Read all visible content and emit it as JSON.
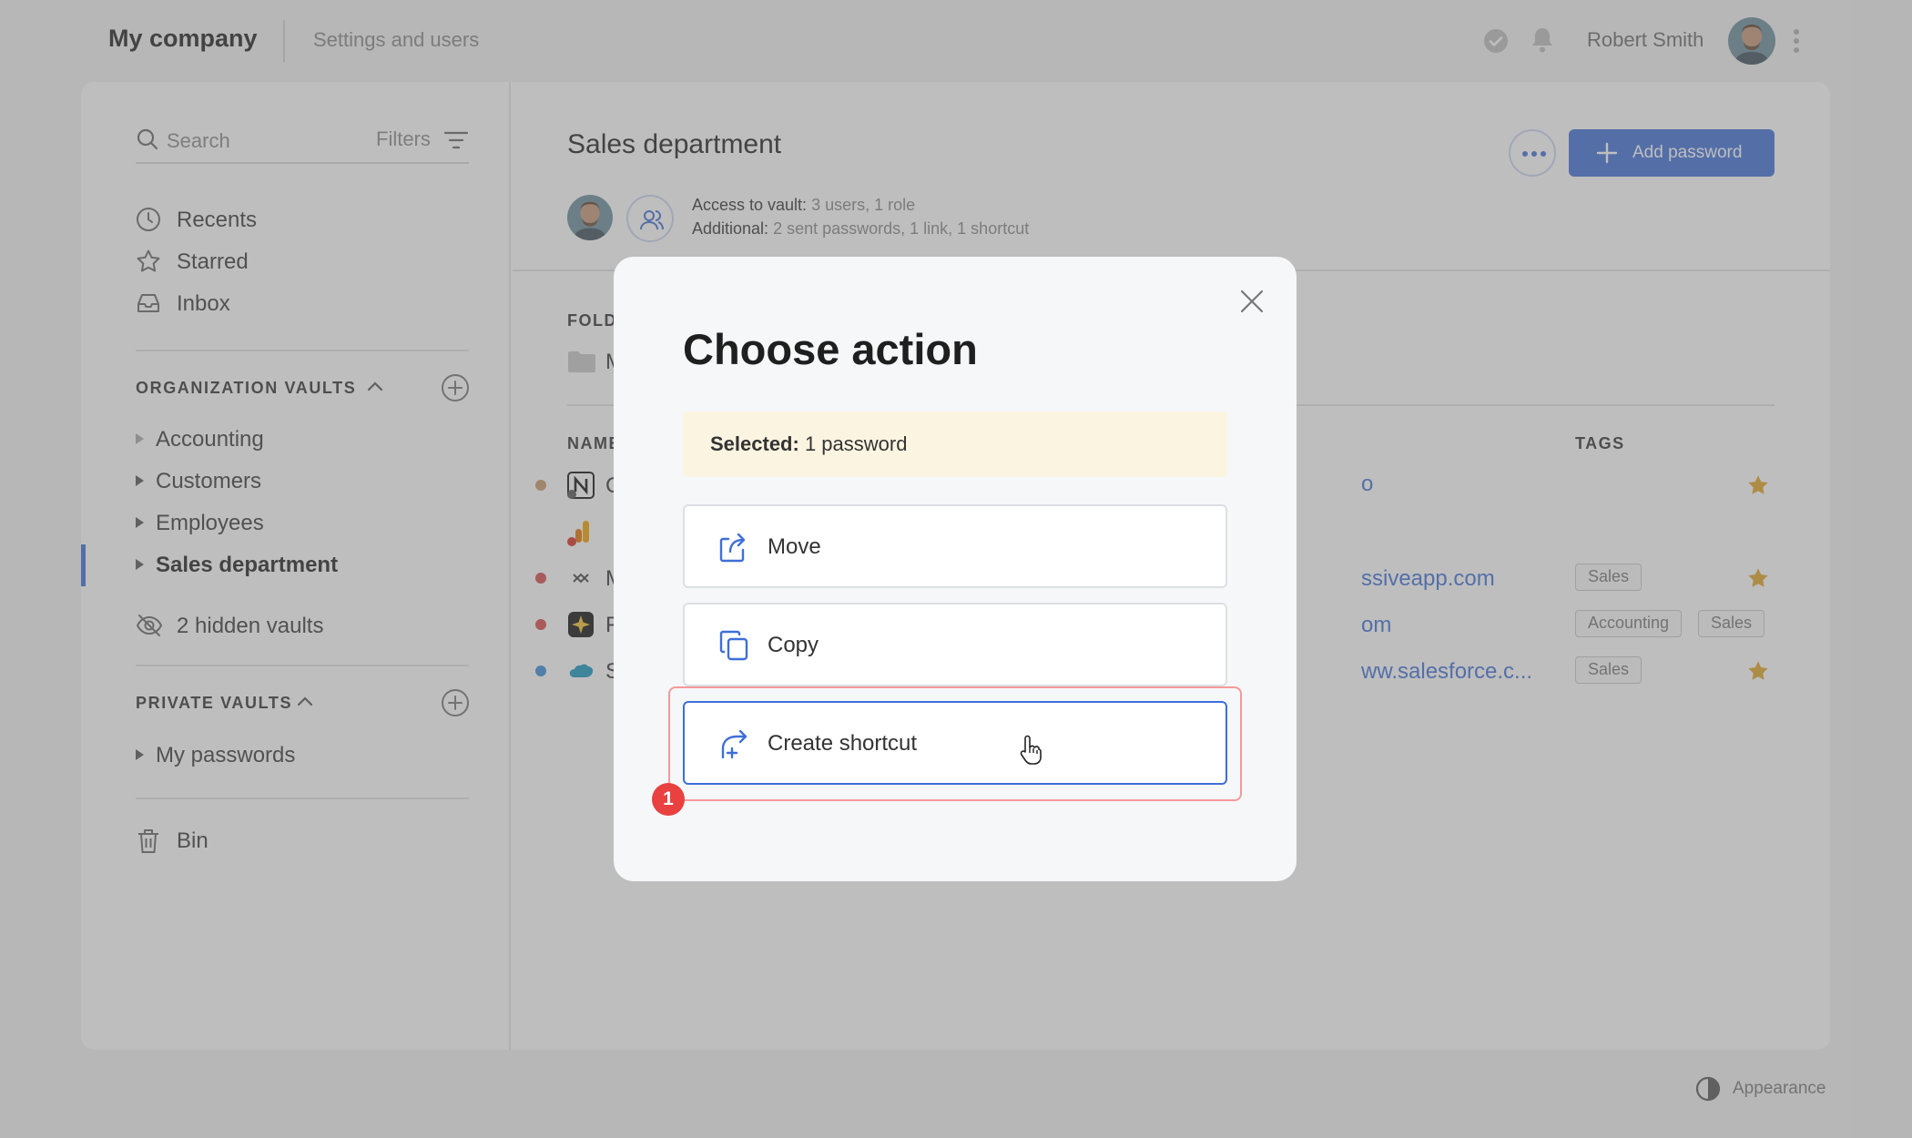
{
  "topbar": {
    "brand": "My company",
    "settings_link": "Settings and users",
    "user_name": "Robert Smith"
  },
  "sidebar": {
    "search_placeholder": "Search",
    "filters_label": "Filters",
    "nav": [
      {
        "label": "Recents",
        "icon": "clock-icon"
      },
      {
        "label": "Starred",
        "icon": "star-outline-icon"
      },
      {
        "label": "Inbox",
        "icon": "inbox-icon"
      }
    ],
    "org_vaults_title": "ORGANIZATION VAULTS",
    "org_vaults": [
      {
        "label": "Accounting"
      },
      {
        "label": "Customers"
      },
      {
        "label": "Employees"
      },
      {
        "label": "Sales department",
        "active": true
      }
    ],
    "hidden_vaults": "2 hidden vaults",
    "private_vaults_title": "PRIVATE VAULTS",
    "private_vaults": [
      {
        "label": "My passwords"
      }
    ],
    "bin": "Bin"
  },
  "content": {
    "title": "Sales department",
    "access_label": "Access to vault:",
    "access_value": "3 users, 1 role",
    "additional_label": "Additional:",
    "additional_value": "2 sent passwords, 1 link, 1 shortcut",
    "add_password": "Add password",
    "folders_header": "FOLD",
    "folder_name_partial": "M",
    "name_header": "NAME",
    "tags_header": "TAGS",
    "rows": [
      {
        "name_partial": "C",
        "dot_color": "#c99a6b",
        "link_partial": "o",
        "tags": [],
        "starred": true
      },
      {
        "name_partial": "",
        "dot_color": "",
        "link_partial": "",
        "tags": [],
        "starred": false
      },
      {
        "name_partial": "M",
        "dot_color": "#d94c4c",
        "link_partial": "ssiveapp.com",
        "tags": [
          "Sales"
        ],
        "starred": true
      },
      {
        "name_partial": "F",
        "dot_color": "#d94c4c",
        "link_partial": "om",
        "tags": [
          "Accounting",
          "Sales"
        ],
        "starred": false
      },
      {
        "name_partial": "S",
        "dot_color": "#3b8fd9",
        "link_partial": "ww.salesforce.c...",
        "tags": [
          "Sales"
        ],
        "starred": true
      }
    ]
  },
  "footer": {
    "appearance": "Appearance"
  },
  "modal": {
    "title": "Choose action",
    "selected_label": "Selected:",
    "selected_value": "1 password",
    "actions": [
      {
        "label": "Move",
        "icon": "move-icon"
      },
      {
        "label": "Copy",
        "icon": "copy-icon"
      },
      {
        "label": "Create shortcut",
        "icon": "shortcut-icon",
        "focused": true
      }
    ],
    "step_badge": "1"
  },
  "colors": {
    "accent": "#3e6fd8",
    "highlight_border": "#f39a9a",
    "badge": "#e94040",
    "selected_bg": "#fbf4e1",
    "star": "#e0a526"
  }
}
